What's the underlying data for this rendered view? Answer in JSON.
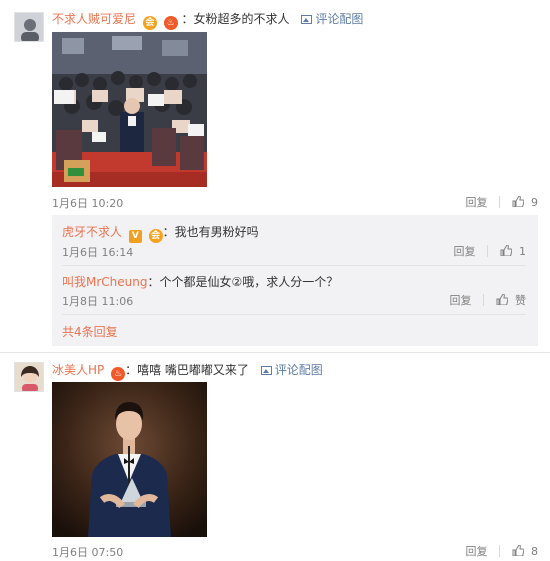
{
  "comment1": {
    "username": "不求人贼可爱尼",
    "text": "：女粉超多的不求人",
    "pic_label": "评论配图",
    "time": "1月6日 10:20",
    "reply_label": "回复",
    "likes": "9"
  },
  "replies": [
    {
      "username": "虎牙不求人",
      "verified_badge": "V",
      "text": "：我也有男粉好吗",
      "time": "1月6日 16:14",
      "reply_label": "回复",
      "likes": "1"
    },
    {
      "username": "叫我MrCheung",
      "text": "：个个都是仙女②哦，求人分一个？",
      "time": "1月8日 11:06",
      "reply_label": "回复",
      "likes": "赞"
    }
  ],
  "more_replies": "共4条回复",
  "comment2": {
    "username": "冰美人HP",
    "text": "：嘻嘻 嘴巴嘟嘟又来了",
    "pic_label": "评论配图",
    "time": "1月6日 07:50",
    "reply_label": "回复",
    "likes": "8"
  },
  "colors": {
    "username": "#eb7350",
    "link": "#5e7ea5",
    "subbox_bg": "#f2f2f5",
    "carpet": "#c0392b"
  },
  "icons": [
    "avatar",
    "vip-badge",
    "fire-badge",
    "verified-badge",
    "picture-icon",
    "thumbs-up-icon"
  ]
}
